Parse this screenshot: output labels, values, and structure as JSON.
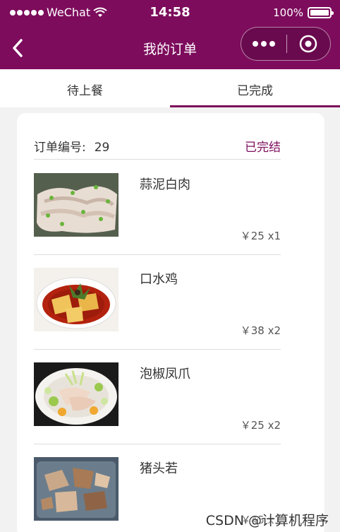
{
  "status": {
    "carrier": "WeChat",
    "time": "14:58",
    "battery": "100%",
    "battery_level": 1.0
  },
  "nav": {
    "title": "我的订单"
  },
  "tabs": [
    {
      "label": "待上餐",
      "active": false
    },
    {
      "label": "已完成",
      "active": true
    }
  ],
  "order": {
    "number_label": "订单编号:",
    "number": "29",
    "status": "已完结",
    "items": [
      {
        "name": "蒜泥白肉",
        "price": "￥25 x1"
      },
      {
        "name": "口水鸡",
        "price": "￥38 x2"
      },
      {
        "name": "泡椒凤爪",
        "price": "￥25 x2"
      },
      {
        "name": "猪头若",
        "price": "￥45 x1"
      }
    ]
  },
  "watermark": "CSDN @计算机程序",
  "colors": {
    "brand": "#7d0c5c",
    "status_done": "#7d0c5c"
  }
}
